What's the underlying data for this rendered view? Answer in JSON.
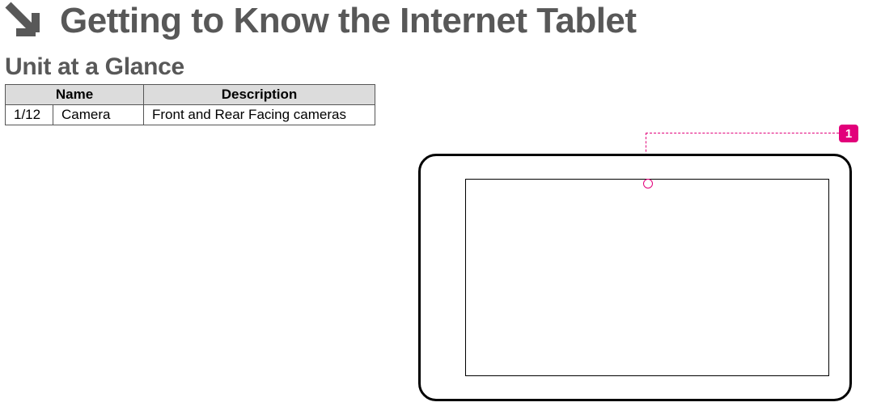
{
  "page_title": "Getting to Know the Internet Tablet",
  "section_title": "Unit at a Glance",
  "table": {
    "headers": {
      "name": "Name",
      "description": "Description"
    },
    "rows": [
      {
        "num": "1/12",
        "name": "Camera",
        "description": "Front and Rear Facing cameras"
      }
    ]
  },
  "callouts": [
    {
      "id": "1"
    }
  ]
}
